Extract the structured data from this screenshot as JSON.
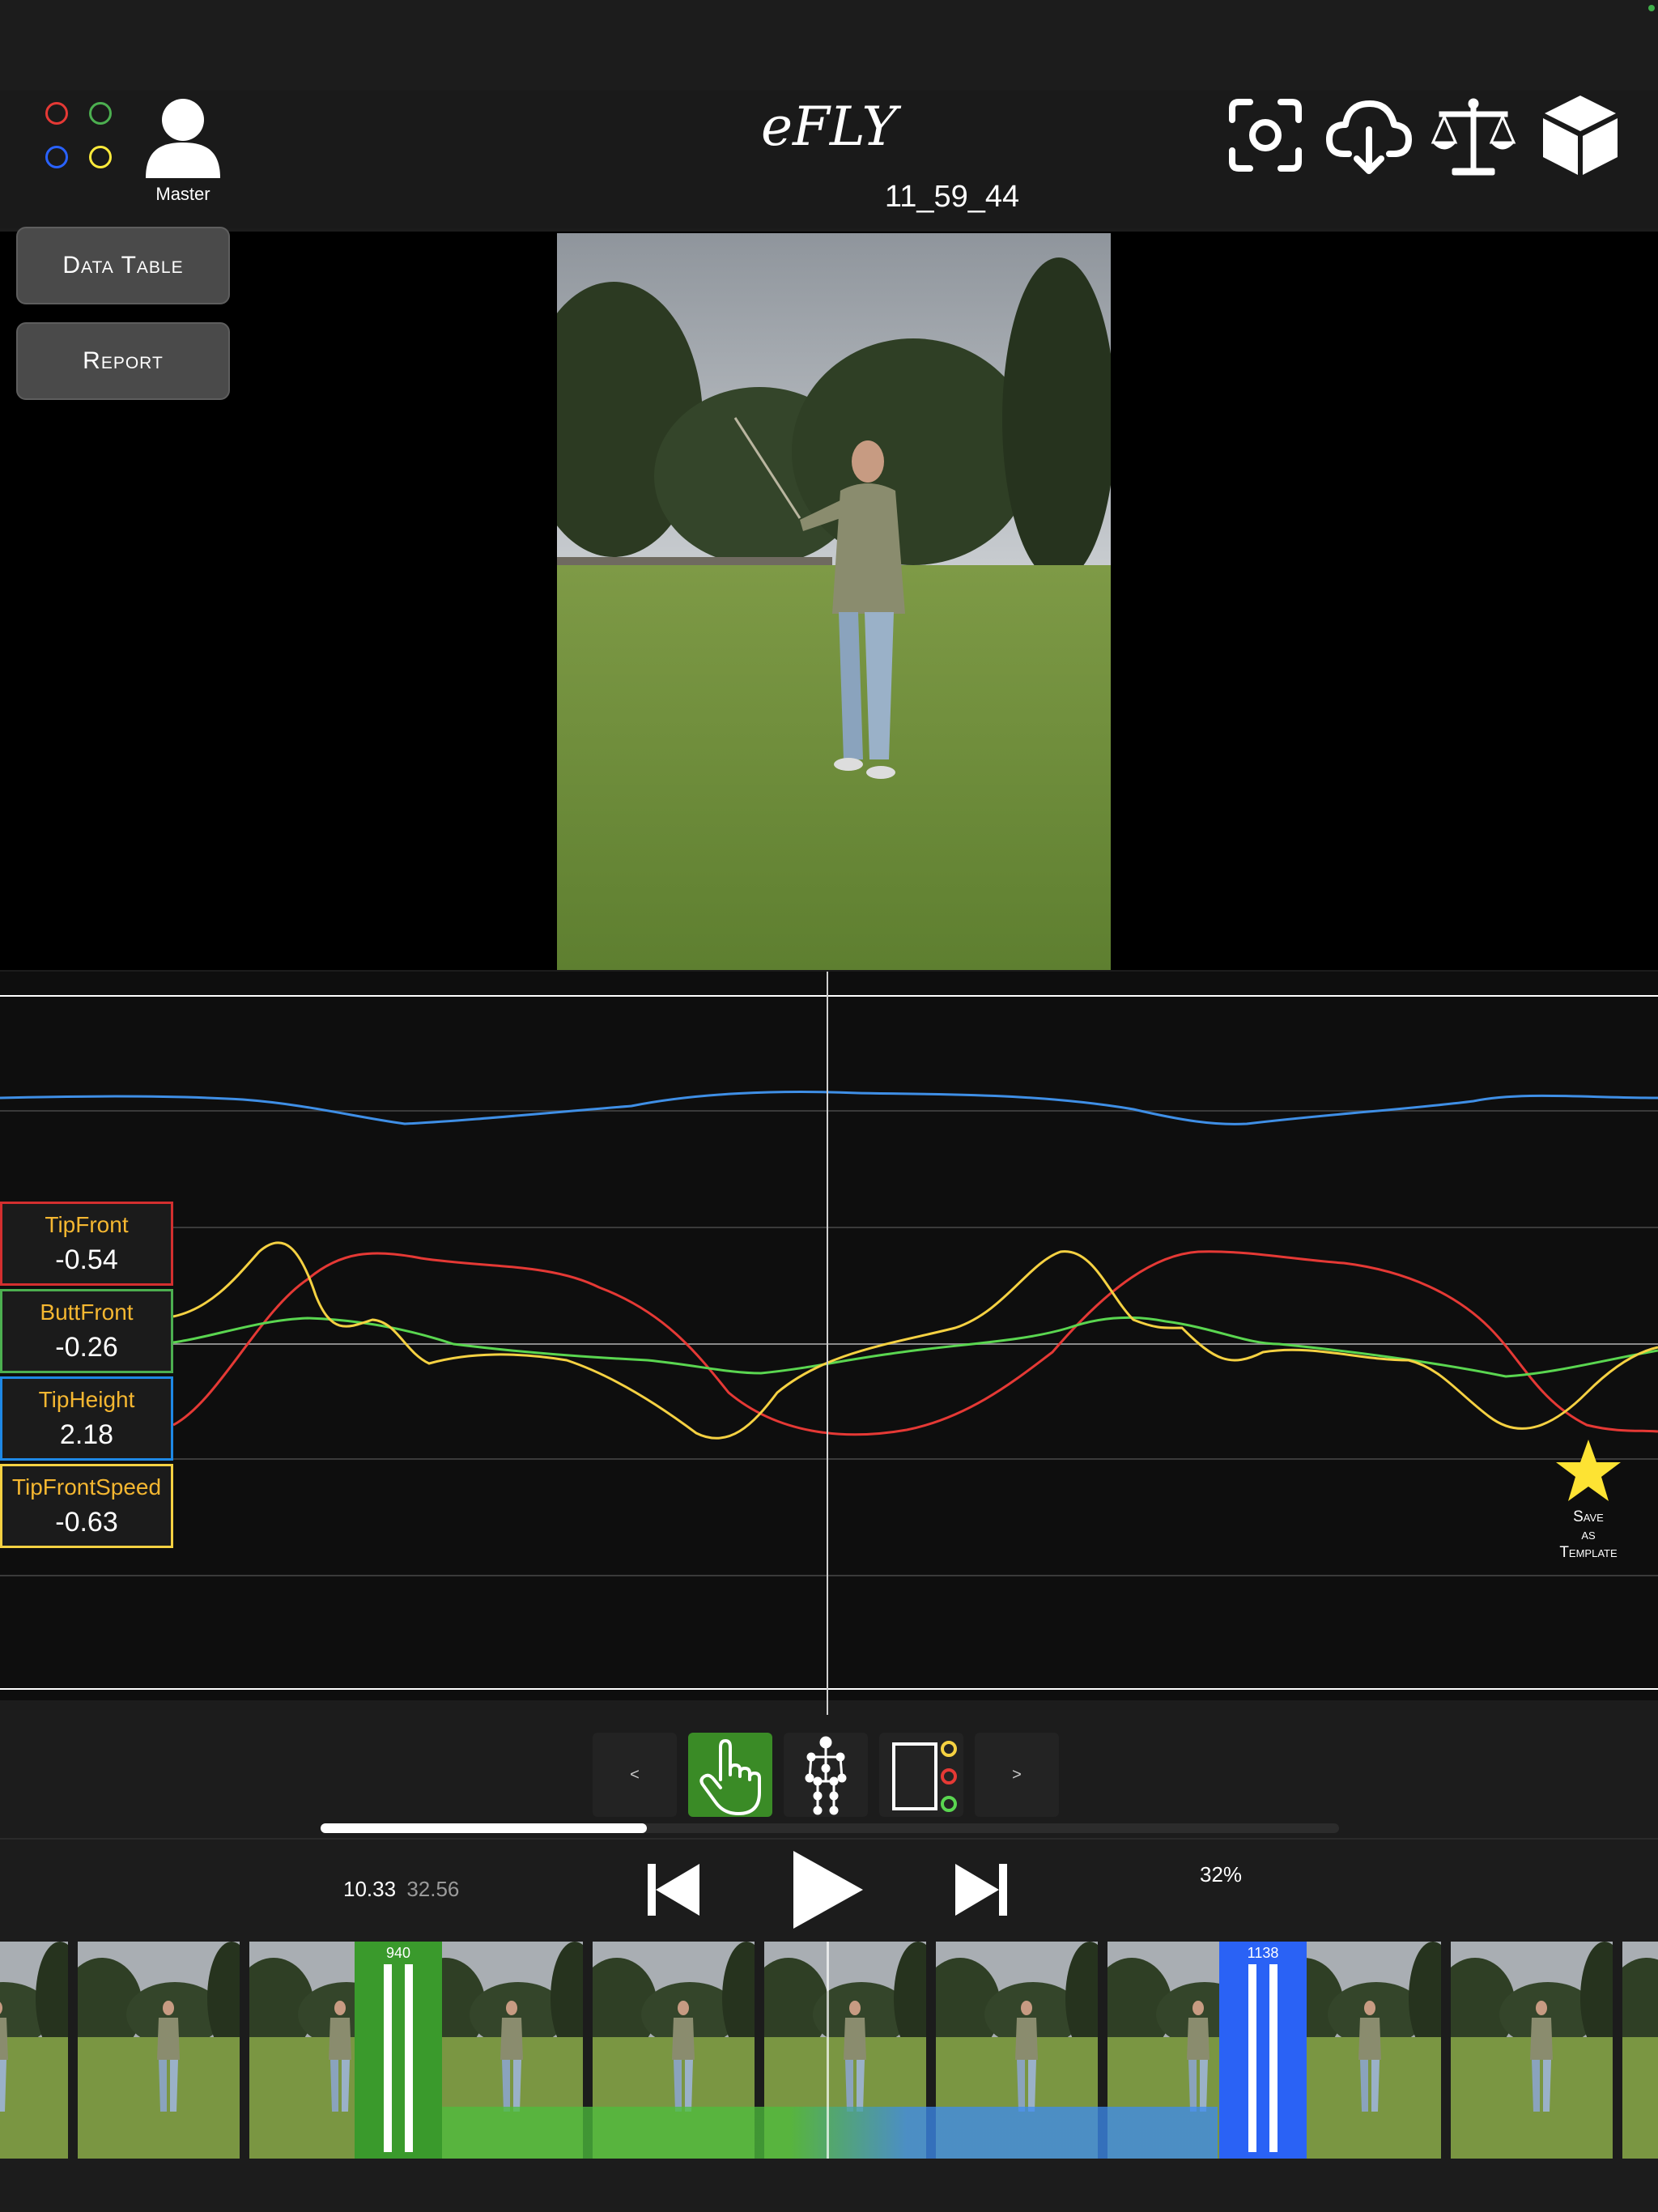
{
  "header": {
    "app_title": "eFLY",
    "user_label": "Master",
    "clip_name": "11_59_44"
  },
  "sidebar": {
    "data_table_label": "Data Table",
    "report_label": "Report"
  },
  "status_colors": [
    "#e53935",
    "#4caf50",
    "#2962ff",
    "#ffeb3b"
  ],
  "legend": [
    {
      "name": "TipFront",
      "value": "-0.54",
      "color": "#d32f2f"
    },
    {
      "name": "ButtFront",
      "value": "-0.26",
      "color": "#4caf50"
    },
    {
      "name": "TipHeight",
      "value": "2.18",
      "color": "#1e88e5"
    },
    {
      "name": "TipFrontSpeed",
      "value": "-0.63",
      "color": "#f5d142"
    }
  ],
  "save_template": {
    "line1": "Save",
    "line2": "as",
    "line3": "Template"
  },
  "toolbar": {
    "prev_label": "<",
    "next_label": ">"
  },
  "transport": {
    "current_time": "10.33",
    "total_time": "32.56",
    "zoom": "32%",
    "progress": 0.32
  },
  "filmstrip": {
    "start_marker": "940",
    "end_marker": "1138"
  },
  "icons": {
    "screenshot": "camera-focus-icon",
    "cloud": "cloud-download-icon",
    "scale": "balance-scale-icon",
    "cube": "cube-icon",
    "user": "user-icon",
    "play": "play-icon",
    "skip_back": "skip-back-icon",
    "skip_forward": "skip-forward-icon",
    "hand": "hand-pointer-icon",
    "skeleton": "skeleton-icon",
    "rod_settings": "rod-markers-icon",
    "star": "star-icon"
  }
}
